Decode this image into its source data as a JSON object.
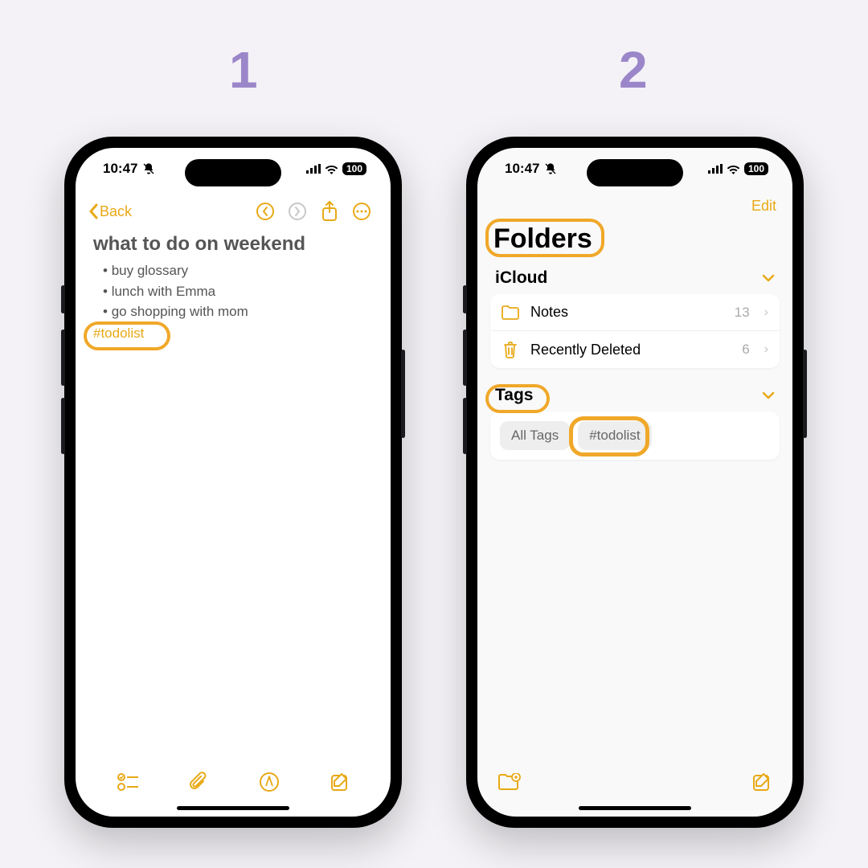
{
  "steps": {
    "one": "1",
    "two": "2"
  },
  "status": {
    "time": "10:47",
    "battery": "100"
  },
  "left": {
    "back": "Back",
    "title": "what to do on weekend",
    "bullets": [
      "buy glossary",
      "lunch with Emma",
      "go shopping with mom"
    ],
    "hashtag": "#todolist"
  },
  "right": {
    "edit": "Edit",
    "title": "Folders",
    "icloud_header": "iCloud",
    "folders": [
      {
        "name": "Notes",
        "count": "13"
      },
      {
        "name": "Recently Deleted",
        "count": "6"
      }
    ],
    "tags_header": "Tags",
    "tags": {
      "all": "All Tags",
      "todo": "#todolist"
    }
  }
}
